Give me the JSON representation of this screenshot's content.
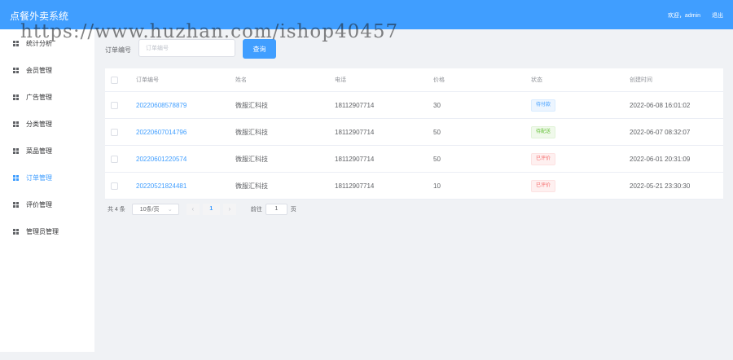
{
  "app": {
    "title": "点餐外卖系统",
    "welcome": "欢迎，admin",
    "logout": "退出"
  },
  "watermark": "https://www.huzhan.com/ishop40457",
  "sidebar": {
    "items": [
      {
        "label": "统计分析",
        "icon": "grid-icon",
        "active": false
      },
      {
        "label": "会员管理",
        "icon": "grid-icon",
        "active": false
      },
      {
        "label": "广告管理",
        "icon": "grid-icon",
        "active": false
      },
      {
        "label": "分类管理",
        "icon": "grid-icon",
        "active": false
      },
      {
        "label": "菜品管理",
        "icon": "grid-icon",
        "active": false
      },
      {
        "label": "订单管理",
        "icon": "grid-icon",
        "active": true
      },
      {
        "label": "评价管理",
        "icon": "grid-icon",
        "active": false
      },
      {
        "label": "管理员管理",
        "icon": "grid-icon",
        "active": false
      }
    ]
  },
  "search": {
    "label": "订单编号",
    "placeholder": "订单编号",
    "value": "",
    "button": "查询"
  },
  "table": {
    "headers": [
      "订单编号",
      "姓名",
      "电话",
      "价格",
      "状态",
      "创建时间"
    ],
    "rows": [
      {
        "order_no": "20220608578879",
        "name": "微服汇科技",
        "phone": "18112907714",
        "price": "30",
        "status": "待付款",
        "created": "2022-06-08 16:01:02"
      },
      {
        "order_no": "20220607014796",
        "name": "微服汇科技",
        "phone": "18112907714",
        "price": "50",
        "status": "待配送",
        "created": "2022-06-07 08:32:07"
      },
      {
        "order_no": "20220601220574",
        "name": "微服汇科技",
        "phone": "18112907714",
        "price": "50",
        "status": "已评价",
        "created": "2022-06-01 20:31:09"
      },
      {
        "order_no": "20220521824481",
        "name": "微服汇科技",
        "phone": "18112907714",
        "price": "10",
        "status": "已评价",
        "created": "2022-05-21 23:30:30"
      }
    ]
  },
  "pagination": {
    "total": "共 4 条",
    "page_size": "10条/页",
    "current_page": "1",
    "goto_label": "前往",
    "goto_value": "1",
    "page_unit": "页"
  },
  "colors": {
    "primary": "#409eff",
    "status_pending_pay": "#409eff",
    "status_pending_delivery": "#67c23a",
    "status_reviewed": "#f56c6c"
  }
}
